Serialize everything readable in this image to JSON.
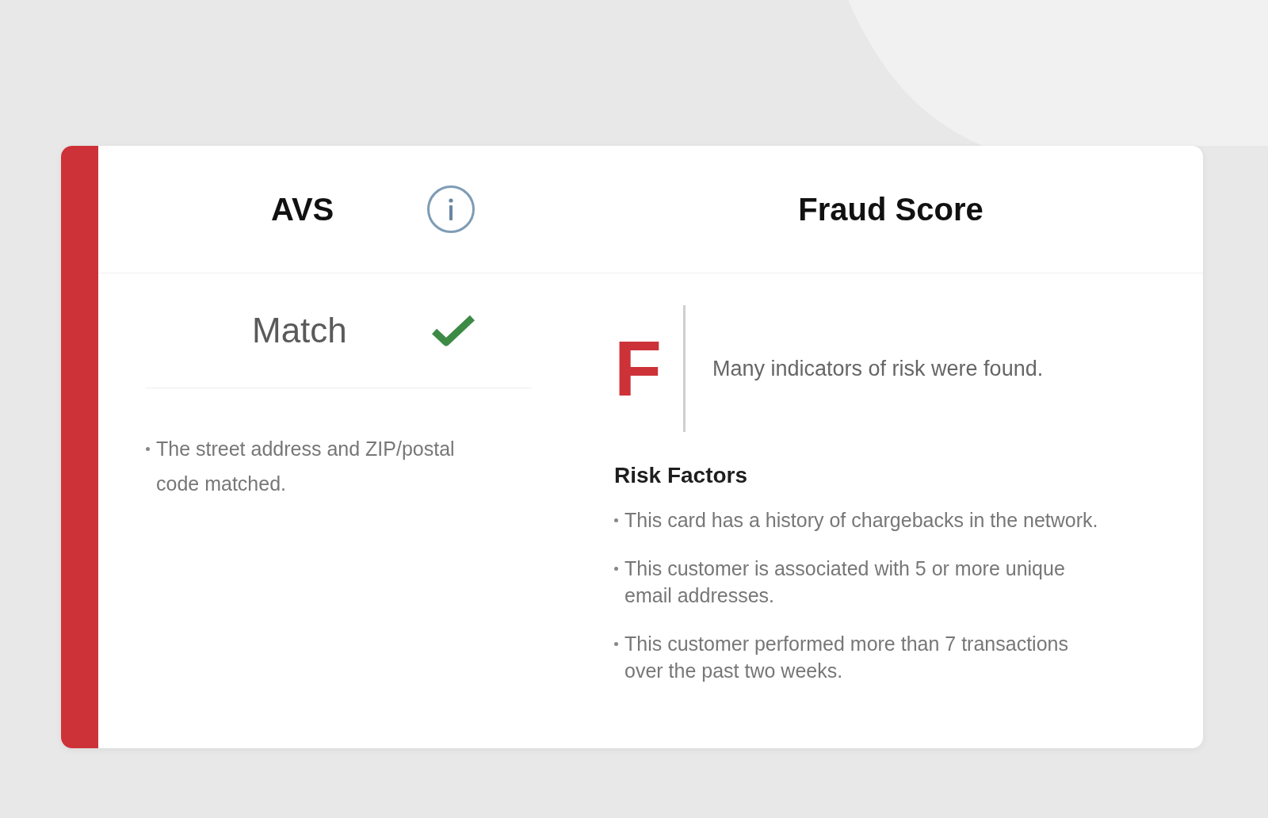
{
  "avs": {
    "title": "AVS",
    "result": {
      "label": "Match",
      "matched": true
    },
    "notes": [
      "The street address and ZIP/postal code matched."
    ]
  },
  "fraud_score": {
    "title": "Fraud Score",
    "high_risk": true,
    "grade": "F",
    "summary": "Many indicators of risk were found.",
    "risk_factors": {
      "title": "Risk Factors",
      "items": [
        "This card has a history of chargebacks in the network.",
        "This customer is associated with 5 or more unique email addresses.",
        "This customer performed more than 7 transactions over the past two weeks."
      ]
    }
  }
}
